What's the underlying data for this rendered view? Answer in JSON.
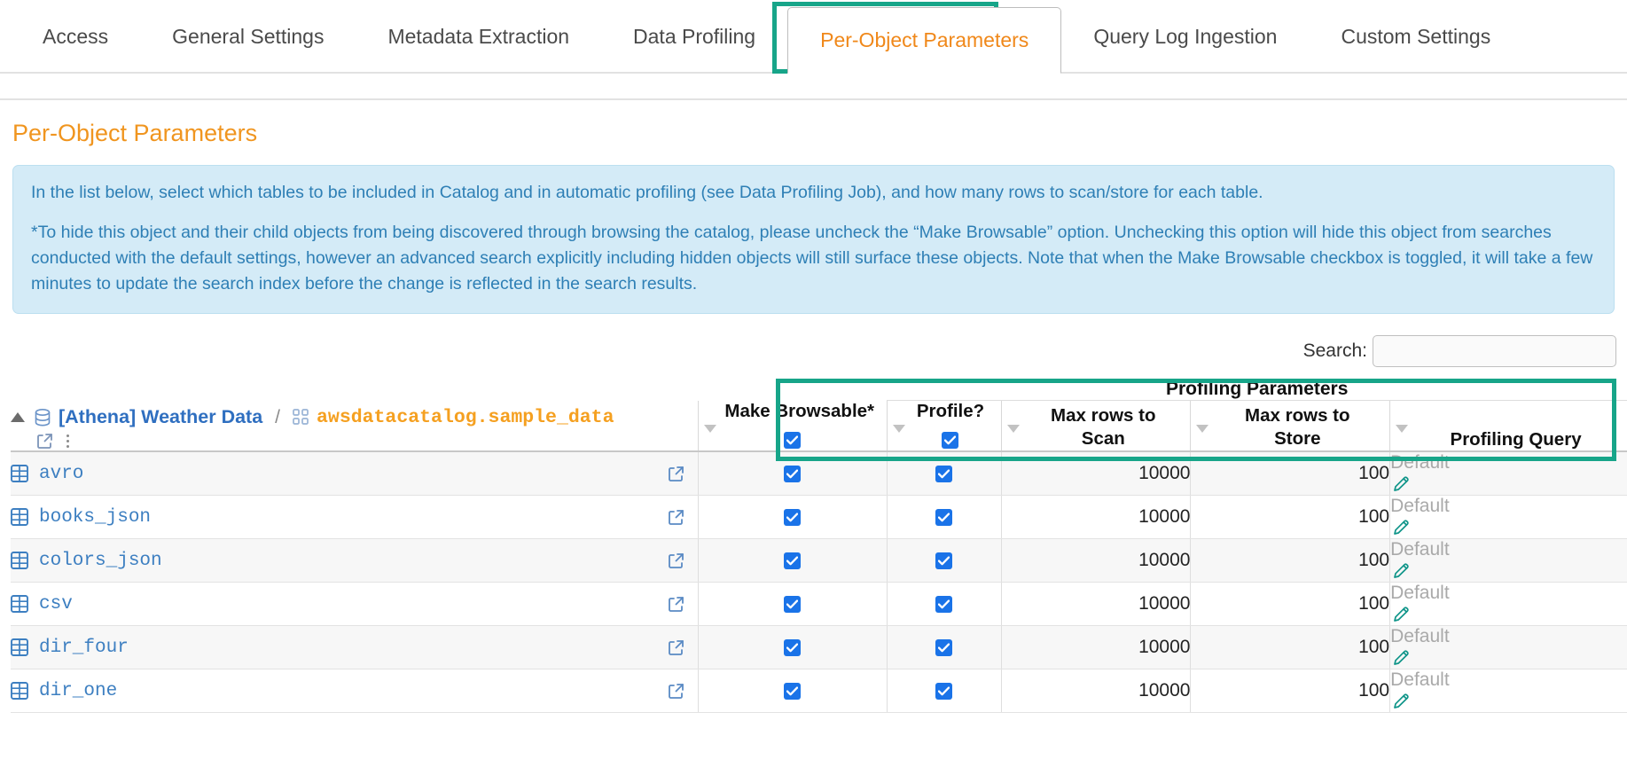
{
  "tabs": [
    {
      "label": "Access",
      "active": false
    },
    {
      "label": "General Settings",
      "active": false
    },
    {
      "label": "Metadata Extraction",
      "active": false
    },
    {
      "label": "Data Profiling",
      "active": false
    },
    {
      "label": "Per-Object Parameters",
      "active": true
    },
    {
      "label": "Query Log Ingestion",
      "active": false
    },
    {
      "label": "Custom Settings",
      "active": false
    }
  ],
  "page": {
    "title": "Per-Object Parameters",
    "info_paragraph_1": "In the list below, select which tables to be included in Catalog and in automatic profiling (see Data Profiling Job), and how many rows to scan/store for each table.",
    "info_paragraph_2": "*To hide this object and their child objects from being discovered through browsing the catalog, please uncheck the “Make Browsable” option. Unchecking this option will hide this object from searches conducted with the default settings, however an advanced search explicitly including hidden objects will still surface these objects. Note that when the Make Browsable checkbox is toggled, it will take a few minutes to update the search index before the change is reflected in the search results."
  },
  "search": {
    "label": "Search:",
    "value": "",
    "placeholder": ""
  },
  "table": {
    "group_header": "Profiling Parameters",
    "breadcrumb": {
      "database": "[Athena] Weather Data",
      "separator": "/",
      "schema": "awsdatacatalog.sample_data"
    },
    "columns": {
      "make_browsable": "Make Browsable*",
      "profile": "Profile?",
      "max_rows_scan": "Max rows to Scan",
      "max_rows_scan_l1": "Max rows to",
      "max_rows_scan_l2": "Scan",
      "max_rows_store": "Max rows to Store",
      "max_rows_store_l1": "Max rows to",
      "max_rows_store_l2": "Store",
      "profiling_query": "Profiling Query"
    },
    "header_row": {
      "make_browsable_checked": true,
      "profile_checked": true
    },
    "rows": [
      {
        "name": "avro",
        "browsable": true,
        "profile": true,
        "max_rows_scan": "10000",
        "max_rows_store": "100",
        "profiling_query": "Default"
      },
      {
        "name": "books_json",
        "browsable": true,
        "profile": true,
        "max_rows_scan": "10000",
        "max_rows_store": "100",
        "profiling_query": "Default"
      },
      {
        "name": "colors_json",
        "browsable": true,
        "profile": true,
        "max_rows_scan": "10000",
        "max_rows_store": "100",
        "profiling_query": "Default"
      },
      {
        "name": "csv",
        "browsable": true,
        "profile": true,
        "max_rows_scan": "10000",
        "max_rows_store": "100",
        "profiling_query": "Default"
      },
      {
        "name": "dir_four",
        "browsable": true,
        "profile": true,
        "max_rows_scan": "10000",
        "max_rows_store": "100",
        "profiling_query": "Default"
      },
      {
        "name": "dir_one",
        "browsable": true,
        "profile": true,
        "max_rows_scan": "10000",
        "max_rows_store": "100",
        "profiling_query": "Default"
      }
    ]
  },
  "colors": {
    "accent_orange": "#f0951f",
    "highlight_teal": "#17a589",
    "link_blue": "#3d7fc1",
    "info_bg": "#d4ebf7",
    "info_text": "#2e7fb5",
    "checkbox_blue": "#1a73e8",
    "pencil_teal": "#0d9488"
  }
}
